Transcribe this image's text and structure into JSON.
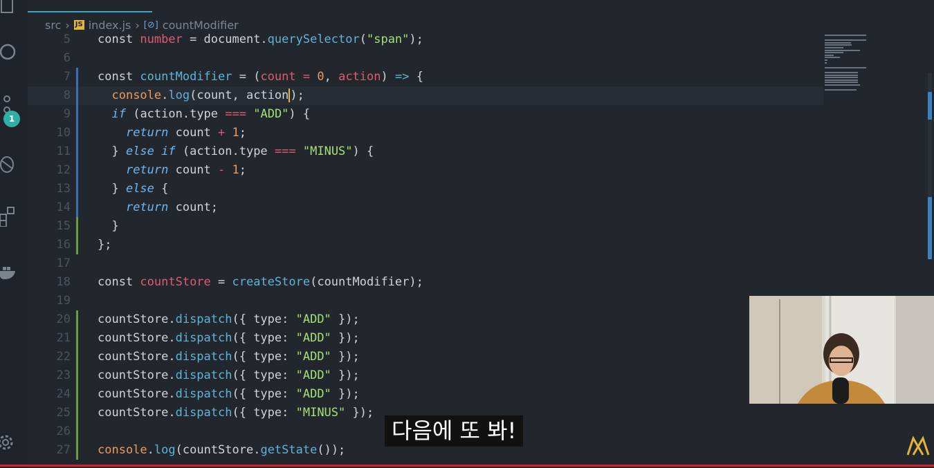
{
  "breadcrumb": {
    "folder": "src",
    "file_badge": "JS",
    "file": "index.js",
    "symbol": "countModifier"
  },
  "activity_bar": {
    "icons": [
      "explorer-icon",
      "search-icon",
      "source-control-icon",
      "debug-icon",
      "extensions-icon",
      "docker-icon",
      "settings-gear-icon"
    ],
    "source_control_badge": "1"
  },
  "editor": {
    "current_line": 8,
    "lines": [
      {
        "n": "5",
        "tokens": [
          [
            "kw",
            "const "
          ],
          [
            "var",
            "number"
          ],
          [
            "kw",
            " = document."
          ],
          [
            "fn",
            "querySelector"
          ],
          [
            "kw",
            "("
          ],
          [
            "str",
            "\"span\""
          ],
          [
            "kw",
            ");"
          ]
        ]
      },
      {
        "n": "6",
        "tokens": []
      },
      {
        "n": "7",
        "tokens": [
          [
            "kw",
            "const "
          ],
          [
            "fn",
            "countModifier"
          ],
          [
            "kw",
            " = ("
          ],
          [
            "var",
            "count"
          ],
          [
            "op",
            " = "
          ],
          [
            "num",
            "0"
          ],
          [
            "kw",
            ", "
          ],
          [
            "var",
            "action"
          ],
          [
            "kw",
            ") "
          ],
          [
            "fn",
            "=>"
          ],
          [
            "kw",
            " {"
          ]
        ]
      },
      {
        "n": "8",
        "tokens": [
          [
            "kw",
            "  "
          ],
          [
            "num",
            "console"
          ],
          [
            "kw",
            "."
          ],
          [
            "fn",
            "log"
          ],
          [
            "kw",
            "(count, action"
          ],
          [
            "cursor",
            ")"
          ],
          [
            "kw",
            ";"
          ]
        ]
      },
      {
        "n": "9",
        "tokens": [
          [
            "kw",
            "  "
          ],
          [
            "ctl",
            "if"
          ],
          [
            "kw",
            " (action.type "
          ],
          [
            "op",
            "==="
          ],
          [
            "kw",
            " "
          ],
          [
            "str",
            "\"ADD\""
          ],
          [
            "kw",
            ") {"
          ]
        ]
      },
      {
        "n": "10",
        "tokens": [
          [
            "kw",
            "    "
          ],
          [
            "ctl",
            "return"
          ],
          [
            "kw",
            " count "
          ],
          [
            "op",
            "+"
          ],
          [
            "kw",
            " "
          ],
          [
            "num",
            "1"
          ],
          [
            "kw",
            ";"
          ]
        ]
      },
      {
        "n": "11",
        "tokens": [
          [
            "kw",
            "  } "
          ],
          [
            "ctl",
            "else if"
          ],
          [
            "kw",
            " (action.type "
          ],
          [
            "op",
            "==="
          ],
          [
            "kw",
            " "
          ],
          [
            "str",
            "\"MINUS\""
          ],
          [
            "kw",
            ") {"
          ]
        ]
      },
      {
        "n": "12",
        "tokens": [
          [
            "kw",
            "    "
          ],
          [
            "ctl",
            "return"
          ],
          [
            "kw",
            " count "
          ],
          [
            "op",
            "-"
          ],
          [
            "kw",
            " "
          ],
          [
            "num",
            "1"
          ],
          [
            "kw",
            ";"
          ]
        ]
      },
      {
        "n": "13",
        "tokens": [
          [
            "kw",
            "  } "
          ],
          [
            "ctl",
            "else"
          ],
          [
            "kw",
            " {"
          ]
        ]
      },
      {
        "n": "14",
        "tokens": [
          [
            "kw",
            "    "
          ],
          [
            "ctl",
            "return"
          ],
          [
            "kw",
            " count;"
          ]
        ]
      },
      {
        "n": "15",
        "tokens": [
          [
            "kw",
            "  }"
          ]
        ]
      },
      {
        "n": "16",
        "tokens": [
          [
            "kw",
            "};"
          ]
        ]
      },
      {
        "n": "17",
        "tokens": []
      },
      {
        "n": "18",
        "tokens": [
          [
            "kw",
            "const "
          ],
          [
            "var",
            "countStore"
          ],
          [
            "kw",
            " = "
          ],
          [
            "fn",
            "createStore"
          ],
          [
            "kw",
            "(countModifier);"
          ]
        ]
      },
      {
        "n": "19",
        "tokens": []
      },
      {
        "n": "20",
        "tokens": [
          [
            "kw",
            "countStore."
          ],
          [
            "fn",
            "dispatch"
          ],
          [
            "kw",
            "({ type: "
          ],
          [
            "str",
            "\"ADD\""
          ],
          [
            "kw",
            " });"
          ]
        ]
      },
      {
        "n": "21",
        "tokens": [
          [
            "kw",
            "countStore."
          ],
          [
            "fn",
            "dispatch"
          ],
          [
            "kw",
            "({ type: "
          ],
          [
            "str",
            "\"ADD\""
          ],
          [
            "kw",
            " });"
          ]
        ]
      },
      {
        "n": "22",
        "tokens": [
          [
            "kw",
            "countStore."
          ],
          [
            "fn",
            "dispatch"
          ],
          [
            "kw",
            "({ type: "
          ],
          [
            "str",
            "\"ADD\""
          ],
          [
            "kw",
            " });"
          ]
        ]
      },
      {
        "n": "23",
        "tokens": [
          [
            "kw",
            "countStore."
          ],
          [
            "fn",
            "dispatch"
          ],
          [
            "kw",
            "({ type: "
          ],
          [
            "str",
            "\"ADD\""
          ],
          [
            "kw",
            " });"
          ]
        ]
      },
      {
        "n": "24",
        "tokens": [
          [
            "kw",
            "countStore."
          ],
          [
            "fn",
            "dispatch"
          ],
          [
            "kw",
            "({ type: "
          ],
          [
            "str",
            "\"ADD\""
          ],
          [
            "kw",
            " });"
          ]
        ]
      },
      {
        "n": "25",
        "tokens": [
          [
            "kw",
            "countStore."
          ],
          [
            "fn",
            "dispatch"
          ],
          [
            "kw",
            "({ type: "
          ],
          [
            "str",
            "\"MINUS\""
          ],
          [
            "kw",
            " });"
          ]
        ]
      },
      {
        "n": "26",
        "tokens": []
      },
      {
        "n": "27",
        "tokens": [
          [
            "num",
            "console"
          ],
          [
            "kw",
            "."
          ],
          [
            "fn",
            "log"
          ],
          [
            "kw",
            "(countStore."
          ],
          [
            "fn",
            "getState"
          ],
          [
            "kw",
            "());"
          ]
        ]
      }
    ]
  },
  "subtitle": "다음에 또 봐!",
  "colors": {
    "background": "#22272e",
    "accent": "#3aa9c9",
    "progress": "#d62424"
  }
}
